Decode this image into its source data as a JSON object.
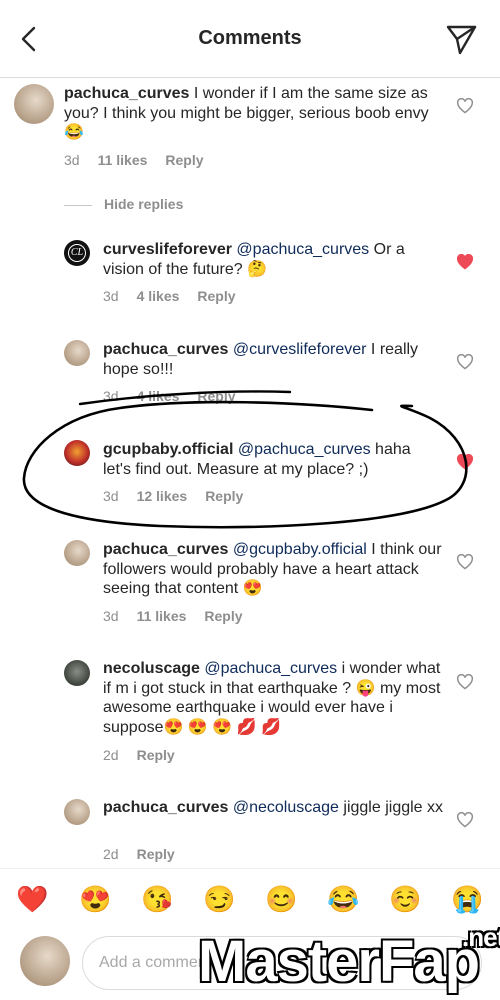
{
  "header": {
    "title": "Comments"
  },
  "hide_replies": "Hide replies",
  "comments": [
    {
      "username": "pachuca_curves",
      "pre": " ",
      "mention": "",
      "text": "I wonder if I am the same size as you? I think you might be bigger, serious boob envy 😂",
      "time": "3d",
      "likes": "11 likes",
      "reply": "Reply",
      "liked": false
    },
    {
      "username": "curveslifeforever",
      "pre": " ",
      "mention": "@pachuca_curves",
      "text": " Or a vision of the future? 🤔",
      "time": "3d",
      "likes": "4 likes",
      "reply": "Reply",
      "liked": true
    },
    {
      "username": "pachuca_curves",
      "pre": " ",
      "mention": "@curveslifeforever",
      "text": " I really hope so!!!",
      "time": "3d",
      "likes": "4 likes",
      "reply": "Reply",
      "liked": false
    },
    {
      "username": "gcupbaby.official",
      "pre": " ",
      "mention": "@pachuca_curves",
      "text": " haha let's find out. Measure at my place? ;)",
      "time": "3d",
      "likes": "12 likes",
      "reply": "Reply",
      "liked": true
    },
    {
      "username": "pachuca_curves",
      "pre": " ",
      "mention": "@gcupbaby.official",
      "text": " I think our followers would probably have a heart attack seeing that content 😍",
      "time": "3d",
      "likes": "11 likes",
      "reply": "Reply",
      "liked": false
    },
    {
      "username": "necoluscage",
      "pre": " ",
      "mention": "@pachuca_curves",
      "text": " i wonder what if m i got stuck in that earthquake ? 😜 my most awesome earthquake i would ever have i suppose😍 😍 😍 💋 💋",
      "time": "2d",
      "likes": "",
      "reply": "Reply",
      "liked": false
    },
    {
      "username": "pachuca_curves",
      "pre": " ",
      "mention": "@necoluscage",
      "text": " jiggle jiggle xx",
      "time": "2d",
      "likes": "",
      "reply": "Reply",
      "liked": false
    }
  ],
  "emoji_bar": [
    "❤️",
    "😍",
    "😘",
    "😏",
    "😊",
    "😂",
    "☺️",
    "😭"
  ],
  "input": {
    "placeholder": "Add a comment..."
  },
  "watermark": {
    "main": "MasterFap",
    "tld": ".net"
  },
  "colors": {
    "liked_heart": "#ed4956",
    "mention": "#0f2b59",
    "meta": "#8e8e8e",
    "circle_annotation": "#000000"
  }
}
